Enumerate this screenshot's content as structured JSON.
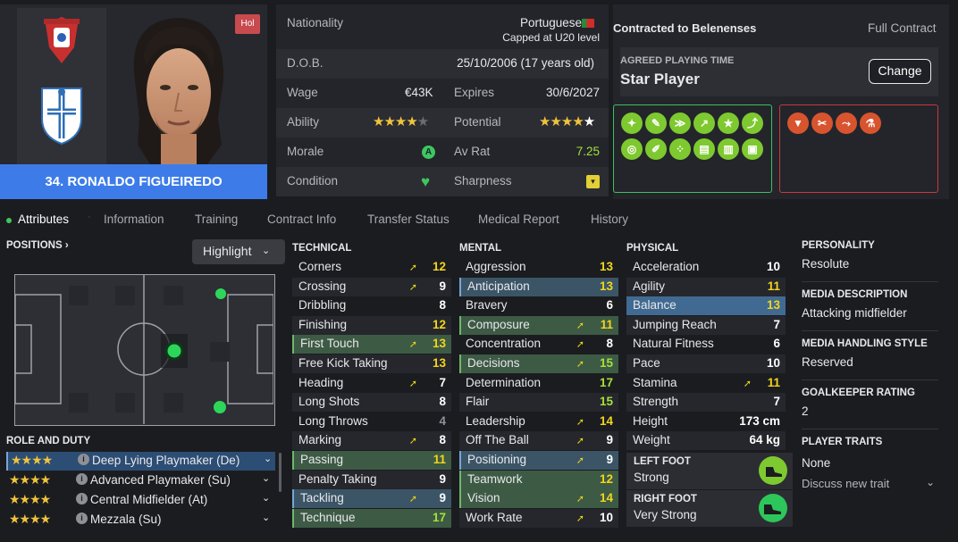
{
  "player": {
    "name": "34. RONALDO FIGUEIREDO",
    "badge": "Hol"
  },
  "info": {
    "nationality_label": "Nationality",
    "nationality": "Portuguese",
    "caps": "Capped at U20 level",
    "dob_label": "D.O.B.",
    "dob": "25/10/2006 (17 years old)",
    "wage_label": "Wage",
    "wage": "€43K",
    "expires_label": "Expires",
    "expires": "30/6/2027",
    "ability_label": "Ability",
    "ability_stars": 4,
    "potential_label": "Potential",
    "potential_stars": 4.5,
    "morale_label": "Morale",
    "morale": "A",
    "avrat_label": "Av Rat",
    "avrat": "7.25",
    "condition_label": "Condition",
    "sharpness_label": "Sharpness"
  },
  "contract": {
    "title": "Contracted to Belenenses",
    "type": "Full Contract",
    "agreed_label": "AGREED PLAYING TIME",
    "agreed_value": "Star Player",
    "change_label": "Change"
  },
  "tabs": [
    "Attributes",
    "Information",
    "Training",
    "Contract Info",
    "Transfer Status",
    "Medical Report",
    "History"
  ],
  "left": {
    "positions_title": "POSITIONS",
    "highlight_label": "Highlight",
    "role_title": "ROLE AND DUTY",
    "roles": [
      {
        "name": "Deep Lying Playmaker (De)",
        "stars": 4
      },
      {
        "name": "Advanced Playmaker (Su)",
        "stars": 4
      },
      {
        "name": "Central Midfielder (At)",
        "stars": 4
      },
      {
        "name": "Mezzala (Su)",
        "stars": 4
      }
    ]
  },
  "attributes": {
    "technical_title": "TECHNICAL",
    "mental_title": "MENTAL",
    "physical_title": "PHYSICAL",
    "technical": [
      {
        "name": "Corners",
        "value": "12",
        "arrow": true
      },
      {
        "name": "Crossing",
        "value": "9",
        "arrow": true
      },
      {
        "name": "Dribbling",
        "value": "8",
        "arrow": false
      },
      {
        "name": "Finishing",
        "value": "12",
        "arrow": false
      },
      {
        "name": "First Touch",
        "value": "13",
        "arrow": true,
        "hl": "green"
      },
      {
        "name": "Free Kick Taking",
        "value": "13",
        "arrow": false
      },
      {
        "name": "Heading",
        "value": "7",
        "arrow": true
      },
      {
        "name": "Long Shots",
        "value": "8",
        "arrow": false
      },
      {
        "name": "Long Throws",
        "value": "4",
        "arrow": false
      },
      {
        "name": "Marking",
        "value": "8",
        "arrow": true
      },
      {
        "name": "Passing",
        "value": "11",
        "arrow": false,
        "hl": "green"
      },
      {
        "name": "Penalty Taking",
        "value": "9",
        "arrow": false
      },
      {
        "name": "Tackling",
        "value": "9",
        "arrow": true,
        "hl": "blue"
      },
      {
        "name": "Technique",
        "value": "17",
        "arrow": false,
        "hl": "green"
      }
    ],
    "mental": [
      {
        "name": "Aggression",
        "value": "13",
        "arrow": false
      },
      {
        "name": "Anticipation",
        "value": "13",
        "arrow": false,
        "hl": "blue"
      },
      {
        "name": "Bravery",
        "value": "6",
        "arrow": false
      },
      {
        "name": "Composure",
        "value": "11",
        "arrow": true,
        "hl": "green"
      },
      {
        "name": "Concentration",
        "value": "8",
        "arrow": true
      },
      {
        "name": "Decisions",
        "value": "15",
        "arrow": true,
        "hl": "green"
      },
      {
        "name": "Determination",
        "value": "17",
        "arrow": false
      },
      {
        "name": "Flair",
        "value": "15",
        "arrow": false
      },
      {
        "name": "Leadership",
        "value": "14",
        "arrow": true
      },
      {
        "name": "Off The Ball",
        "value": "9",
        "arrow": true
      },
      {
        "name": "Positioning",
        "value": "9",
        "arrow": true,
        "hl": "blue"
      },
      {
        "name": "Teamwork",
        "value": "12",
        "arrow": false,
        "hl": "green"
      },
      {
        "name": "Vision",
        "value": "14",
        "arrow": true,
        "hl": "green"
      },
      {
        "name": "Work Rate",
        "value": "10",
        "arrow": true
      }
    ],
    "physical": [
      {
        "name": "Acceleration",
        "value": "10",
        "arrow": false
      },
      {
        "name": "Agility",
        "value": "11",
        "arrow": false
      },
      {
        "name": "Balance",
        "value": "13",
        "arrow": false,
        "hl": "strong"
      },
      {
        "name": "Jumping Reach",
        "value": "7",
        "arrow": false
      },
      {
        "name": "Natural Fitness",
        "value": "6",
        "arrow": false
      },
      {
        "name": "Pace",
        "value": "10",
        "arrow": false
      },
      {
        "name": "Stamina",
        "value": "11",
        "arrow": true
      },
      {
        "name": "Strength",
        "value": "7",
        "arrow": false
      },
      {
        "name": "Height",
        "value": "173 cm",
        "arrow": false
      },
      {
        "name": "Weight",
        "value": "64 kg",
        "arrow": false
      }
    ],
    "left_foot_label": "LEFT FOOT",
    "left_foot": "Strong",
    "right_foot_label": "RIGHT FOOT",
    "right_foot": "Very Strong"
  },
  "side": {
    "personality_title": "PERSONALITY",
    "personality": "Resolute",
    "media_desc_title": "MEDIA DESCRIPTION",
    "media_desc": "Attacking midfielder",
    "media_style_title": "MEDIA HANDLING STYLE",
    "media_style": "Reserved",
    "gk_title": "GOALKEEPER RATING",
    "gk": "2",
    "traits_title": "PLAYER TRAITS",
    "traits": "None",
    "discuss": "Discuss new trait"
  },
  "colors": {
    "accent": "#3d7ce8",
    "good": "#3fbf5e",
    "bad": "#c9393e",
    "value_green": "#a6e03a",
    "value_yellow": "#f2d51c"
  }
}
